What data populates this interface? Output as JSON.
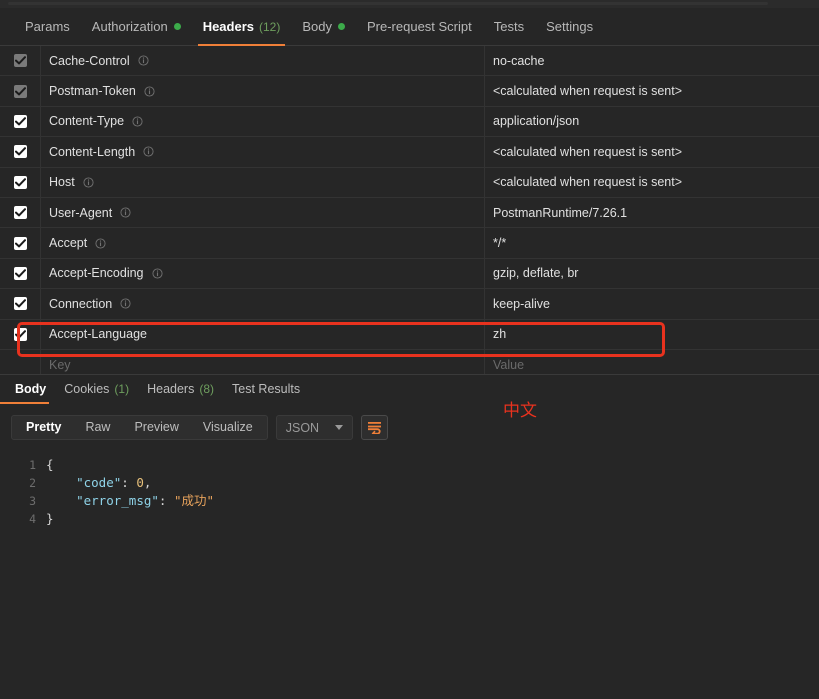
{
  "request_tabs": [
    {
      "label": "Params",
      "active": false,
      "count": null,
      "dot": false
    },
    {
      "label": "Authorization",
      "active": false,
      "count": null,
      "dot": true
    },
    {
      "label": "Headers",
      "active": true,
      "count": "(12)",
      "dot": false
    },
    {
      "label": "Body",
      "active": false,
      "count": null,
      "dot": true
    },
    {
      "label": "Pre-request Script",
      "active": false,
      "count": null,
      "dot": false
    },
    {
      "label": "Tests",
      "active": false,
      "count": null,
      "dot": false
    },
    {
      "label": "Settings",
      "active": false,
      "count": null,
      "dot": false
    }
  ],
  "headers_table": {
    "column_placeholders": {
      "key": "Key",
      "value": "Value"
    },
    "rows": [
      {
        "checked": true,
        "dim": true,
        "info": true,
        "key": "Cache-Control",
        "value": "no-cache"
      },
      {
        "checked": true,
        "dim": true,
        "info": true,
        "key": "Postman-Token",
        "value": "<calculated when request is sent>"
      },
      {
        "checked": true,
        "dim": false,
        "info": true,
        "key": "Content-Type",
        "value": "application/json"
      },
      {
        "checked": true,
        "dim": false,
        "info": true,
        "key": "Content-Length",
        "value": "<calculated when request is sent>"
      },
      {
        "checked": true,
        "dim": false,
        "info": true,
        "key": "Host",
        "value": "<calculated when request is sent>"
      },
      {
        "checked": true,
        "dim": false,
        "info": true,
        "key": "User-Agent",
        "value": "PostmanRuntime/7.26.1"
      },
      {
        "checked": true,
        "dim": false,
        "info": true,
        "key": "Accept",
        "value": "*/*"
      },
      {
        "checked": true,
        "dim": false,
        "info": true,
        "key": "Accept-Encoding",
        "value": "gzip, deflate, br"
      },
      {
        "checked": true,
        "dim": false,
        "info": true,
        "key": "Connection",
        "value": "keep-alive"
      },
      {
        "checked": true,
        "dim": false,
        "info": false,
        "key": "Accept-Language",
        "value": "zh"
      }
    ]
  },
  "annotation": {
    "note_text": "中文",
    "highlight_color": "#e8321e"
  },
  "response_tabs": [
    {
      "label": "Body",
      "active": true,
      "count": null
    },
    {
      "label": "Cookies",
      "active": false,
      "count": "(1)"
    },
    {
      "label": "Headers",
      "active": false,
      "count": "(8)"
    },
    {
      "label": "Test Results",
      "active": false,
      "count": null
    }
  ],
  "body_toolbar": {
    "view_modes": [
      {
        "label": "Pretty",
        "active": true
      },
      {
        "label": "Raw",
        "active": false
      },
      {
        "label": "Preview",
        "active": false
      },
      {
        "label": "Visualize",
        "active": false
      }
    ],
    "format_selected": "JSON",
    "wrap_icon": "word-wrap-icon"
  },
  "code": {
    "lines": [
      {
        "number": "1",
        "tokens": [
          {
            "t": "{",
            "c": "tok-punct"
          }
        ]
      },
      {
        "number": "2",
        "tokens": [
          {
            "t": "    ",
            "c": "tok-punct"
          },
          {
            "t": "\"code\"",
            "c": "tok-key"
          },
          {
            "t": ": ",
            "c": "tok-punct"
          },
          {
            "t": "0",
            "c": "tok-num"
          },
          {
            "t": ",",
            "c": "tok-punct"
          }
        ]
      },
      {
        "number": "3",
        "tokens": [
          {
            "t": "    ",
            "c": "tok-punct"
          },
          {
            "t": "\"error_msg\"",
            "c": "tok-key"
          },
          {
            "t": ": ",
            "c": "tok-punct"
          },
          {
            "t": "\"成功\"",
            "c": "tok-str"
          }
        ]
      },
      {
        "number": "4",
        "tokens": [
          {
            "t": "}",
            "c": "tok-punct"
          }
        ]
      }
    ]
  }
}
